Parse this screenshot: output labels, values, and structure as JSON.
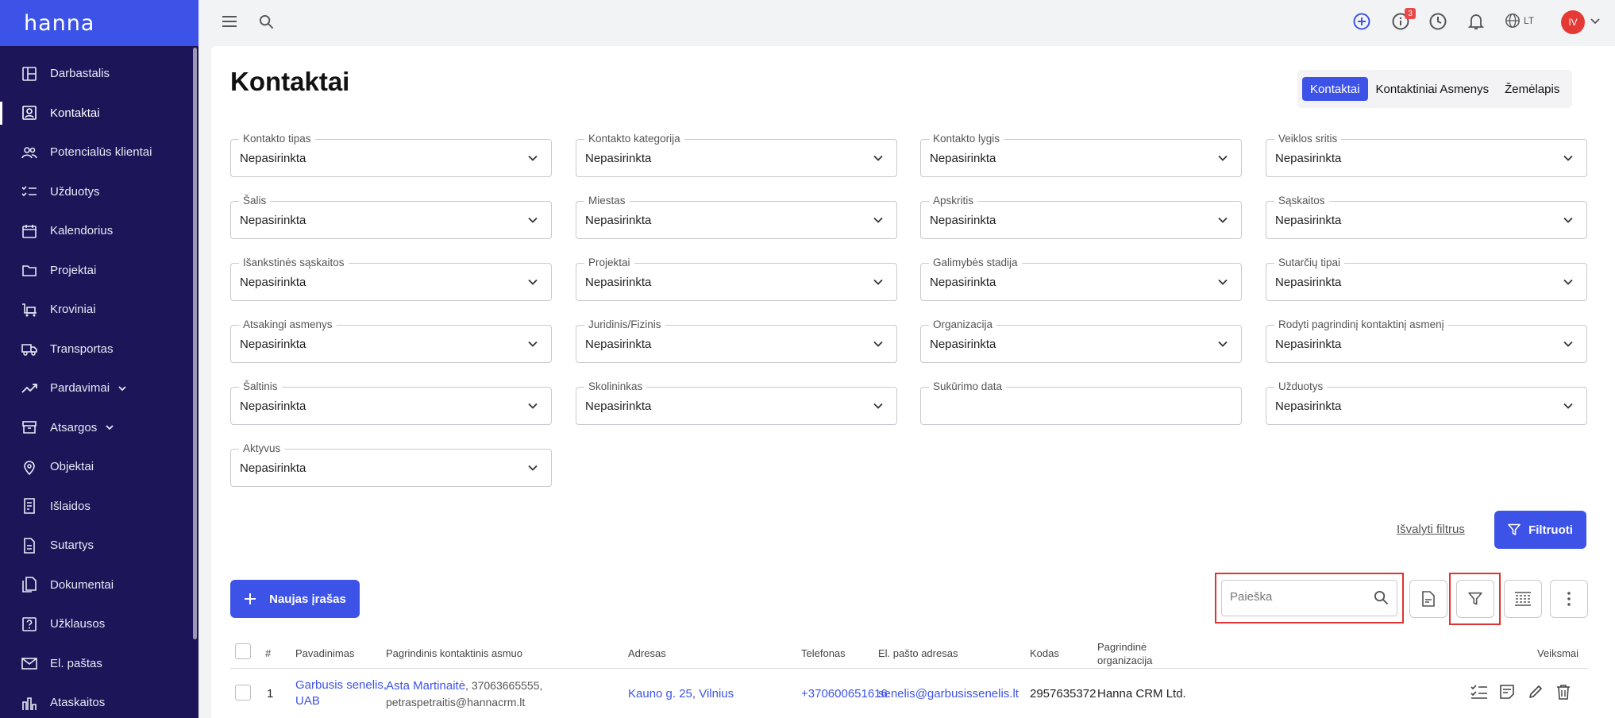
{
  "app": {
    "logo": "hanna"
  },
  "sidebar": {
    "items": [
      {
        "label": "Darbastalis",
        "icon": "dashboard-icon",
        "active": false
      },
      {
        "label": "Kontaktai",
        "icon": "contacts-icon",
        "active": true
      },
      {
        "label": "Potencialūs klientai",
        "icon": "leads-icon",
        "active": false
      },
      {
        "label": "Užduotys",
        "icon": "tasks-icon",
        "active": false
      },
      {
        "label": "Kalendorius",
        "icon": "calendar-icon",
        "active": false
      },
      {
        "label": "Projektai",
        "icon": "folder-icon",
        "active": false
      },
      {
        "label": "Kroviniai",
        "icon": "cargo-icon",
        "active": false
      },
      {
        "label": "Transportas",
        "icon": "truck-icon",
        "active": false
      },
      {
        "label": "Pardavimai",
        "icon": "sales-icon",
        "active": false,
        "expandable": true
      },
      {
        "label": "Atsargos",
        "icon": "inventory-icon",
        "active": false,
        "expandable": true
      },
      {
        "label": "Objektai",
        "icon": "location-icon",
        "active": false
      },
      {
        "label": "Išlaidos",
        "icon": "expenses-icon",
        "active": false
      },
      {
        "label": "Sutartys",
        "icon": "contract-icon",
        "active": false
      },
      {
        "label": "Dokumentai",
        "icon": "documents-icon",
        "active": false
      },
      {
        "label": "Užklausos",
        "icon": "inquiry-icon",
        "active": false
      },
      {
        "label": "El. paštas",
        "icon": "mail-icon",
        "active": false
      },
      {
        "label": "Ataskaitos",
        "icon": "reports-icon",
        "active": false
      }
    ]
  },
  "topbar": {
    "notifications_count": "3",
    "language": "LT",
    "user_initials": "IV"
  },
  "page": {
    "title": "Kontaktai",
    "tabs": [
      {
        "label": "Kontaktai",
        "active": true
      },
      {
        "label": "Kontaktiniai Asmenys",
        "active": false
      },
      {
        "label": "Žemėlapis",
        "active": false
      }
    ]
  },
  "filters": [
    {
      "label": "Kontakto tipas",
      "value": "Nepasirinkta",
      "dropdown": true
    },
    {
      "label": "Kontakto kategorija",
      "value": "Nepasirinkta",
      "dropdown": true
    },
    {
      "label": "Kontakto lygis",
      "value": "Nepasirinkta",
      "dropdown": true
    },
    {
      "label": "Veiklos sritis",
      "value": "Nepasirinkta",
      "dropdown": true
    },
    {
      "label": "Šalis",
      "value": "Nepasirinkta",
      "dropdown": true
    },
    {
      "label": "Miestas",
      "value": "Nepasirinkta",
      "dropdown": true
    },
    {
      "label": "Apskritis",
      "value": "Nepasirinkta",
      "dropdown": true
    },
    {
      "label": "Sąskaitos",
      "value": "Nepasirinkta",
      "dropdown": true
    },
    {
      "label": "Išankstinės sąskaitos",
      "value": "Nepasirinkta",
      "dropdown": true
    },
    {
      "label": "Projektai",
      "value": "Nepasirinkta",
      "dropdown": true
    },
    {
      "label": "Galimybės stadija",
      "value": "Nepasirinkta",
      "dropdown": true
    },
    {
      "label": "Sutarčių tipai",
      "value": "Nepasirinkta",
      "dropdown": true
    },
    {
      "label": "Atsakingi asmenys",
      "value": "Nepasirinkta",
      "dropdown": true
    },
    {
      "label": "Juridinis/Fizinis",
      "value": "Nepasirinkta",
      "dropdown": true
    },
    {
      "label": "Organizacija",
      "value": "Nepasirinkta",
      "dropdown": true
    },
    {
      "label": "Rodyti pagrindinį kontaktinį asmenį",
      "value": "Nepasirinkta",
      "dropdown": true
    },
    {
      "label": "Šaltinis",
      "value": "Nepasirinkta",
      "dropdown": true
    },
    {
      "label": "Skolininkas",
      "value": "Nepasirinkta",
      "dropdown": true
    },
    {
      "label": "Sukūrimo data",
      "value": "",
      "dropdown": false
    },
    {
      "label": "Užduotys",
      "value": "Nepasirinkta",
      "dropdown": true
    },
    {
      "label": "Aktyvus",
      "value": "Nepasirinkta",
      "dropdown": true
    }
  ],
  "actions": {
    "clear_filters": "Išvalyti filtrus",
    "filter_button": "Filtruoti",
    "new_record": "Naujas įrašas",
    "search_placeholder": "Paieška"
  },
  "table": {
    "headers": {
      "num": "#",
      "name": "Pavadinimas",
      "contact": "Pagrindinis kontaktinis asmuo",
      "address": "Adresas",
      "phone": "Telefonas",
      "email": "El. pašto adresas",
      "code": "Kodas",
      "org_line1": "Pagrindinė",
      "org_line2": "organizacija",
      "actions": "Veiksmai"
    },
    "rows": [
      {
        "num": "1",
        "name_line1": "Garbusis senelis,",
        "name_line2": "UAB",
        "contact_name": "Asta Martinaitė",
        "contact_phone": ", 37063665555,",
        "contact_email": "petraspetraitis@hannacrm.lt",
        "address": "Kauno g. 25, Vilnius",
        "phone": "+370600651616",
        "email": "senelis@garbusissenelis.lt",
        "code": "2957635372",
        "org": "Hanna CRM Ltd."
      }
    ]
  },
  "colors": {
    "accent": "#3d53e8",
    "sidebar": "#1c1558",
    "highlight": "#e03333"
  }
}
